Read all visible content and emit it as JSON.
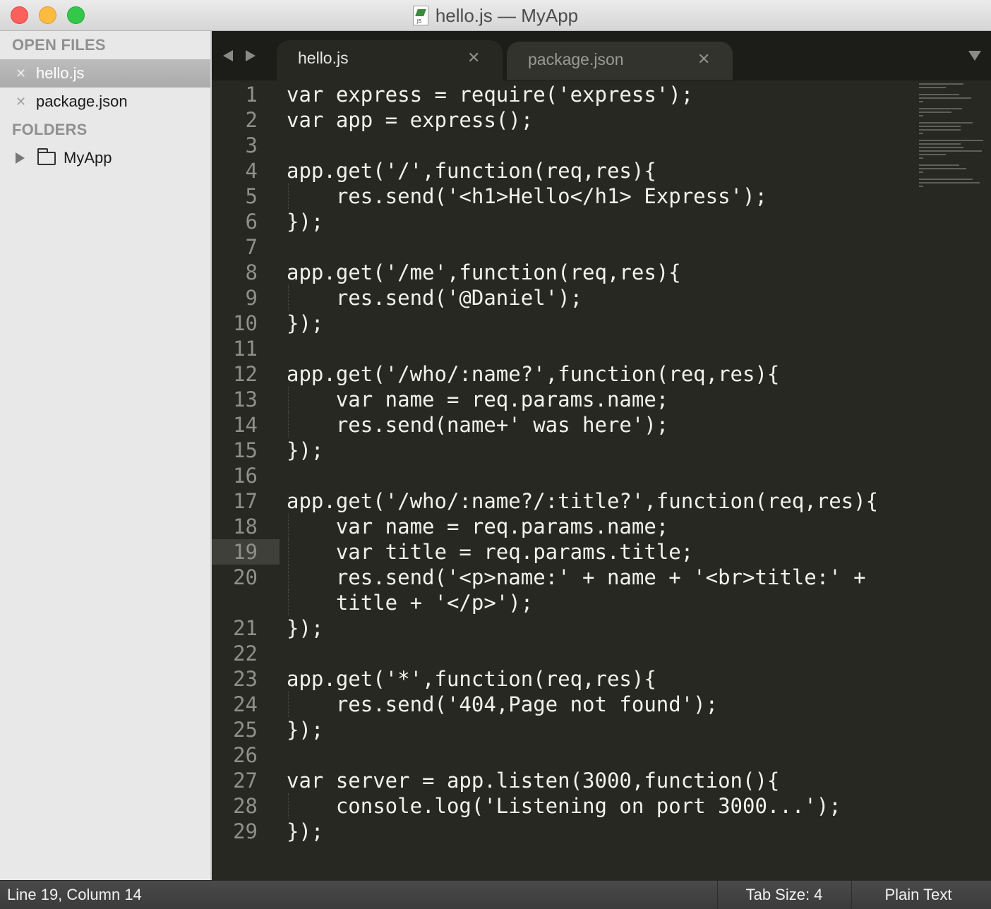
{
  "window": {
    "title": "hello.js — MyApp"
  },
  "sidebar": {
    "open_files_header": "OPEN FILES",
    "open_files": [
      {
        "name": "hello.js",
        "selected": true
      },
      {
        "name": "package.json",
        "selected": false
      }
    ],
    "folders_header": "FOLDERS",
    "folders": [
      {
        "name": "MyApp"
      }
    ]
  },
  "tabs": [
    {
      "label": "hello.js",
      "active": true
    },
    {
      "label": "package.json",
      "active": false
    }
  ],
  "editor": {
    "current_line": 19,
    "lines": [
      {
        "num": "1",
        "text": "var express = require('express');"
      },
      {
        "num": "2",
        "text": "var app = express();"
      },
      {
        "num": "3",
        "text": ""
      },
      {
        "num": "4",
        "text": "app.get('/',function(req,res){"
      },
      {
        "num": "5",
        "text": "    res.send('<h1>Hello</h1> Express');"
      },
      {
        "num": "6",
        "text": "});"
      },
      {
        "num": "7",
        "text": ""
      },
      {
        "num": "8",
        "text": "app.get('/me',function(req,res){"
      },
      {
        "num": "9",
        "text": "    res.send('@Daniel');"
      },
      {
        "num": "10",
        "text": "});"
      },
      {
        "num": "11",
        "text": ""
      },
      {
        "num": "12",
        "text": "app.get('/who/:name?',function(req,res){"
      },
      {
        "num": "13",
        "text": "    var name = req.params.name;"
      },
      {
        "num": "14",
        "text": "    res.send(name+' was here');"
      },
      {
        "num": "15",
        "text": "});"
      },
      {
        "num": "16",
        "text": ""
      },
      {
        "num": "17",
        "text": "app.get('/who/:name?/:title?',function(req,res){"
      },
      {
        "num": "18",
        "text": "    var name = req.params.name;"
      },
      {
        "num": "19",
        "text": "    var title = req.params.title;"
      },
      {
        "num": "20",
        "text": "    res.send('<p>name:' + name + '<br>title:' +"
      },
      {
        "num": "",
        "text": "    title + '</p>');"
      },
      {
        "num": "21",
        "text": "});"
      },
      {
        "num": "22",
        "text": ""
      },
      {
        "num": "23",
        "text": "app.get('*',function(req,res){"
      },
      {
        "num": "24",
        "text": "    res.send('404,Page not found');"
      },
      {
        "num": "25",
        "text": "});"
      },
      {
        "num": "26",
        "text": ""
      },
      {
        "num": "27",
        "text": "var server = app.listen(3000,function(){"
      },
      {
        "num": "28",
        "text": "    console.log('Listening on port 3000...');"
      },
      {
        "num": "29",
        "text": "});"
      }
    ]
  },
  "statusbar": {
    "position": "Line 19, Column 14",
    "tab_size": "Tab Size: 4",
    "syntax": "Plain Text"
  },
  "colors": {
    "editor_bg": "#272822",
    "sidebar_bg": "#e8e8e8",
    "text": "#f2f2ec"
  }
}
